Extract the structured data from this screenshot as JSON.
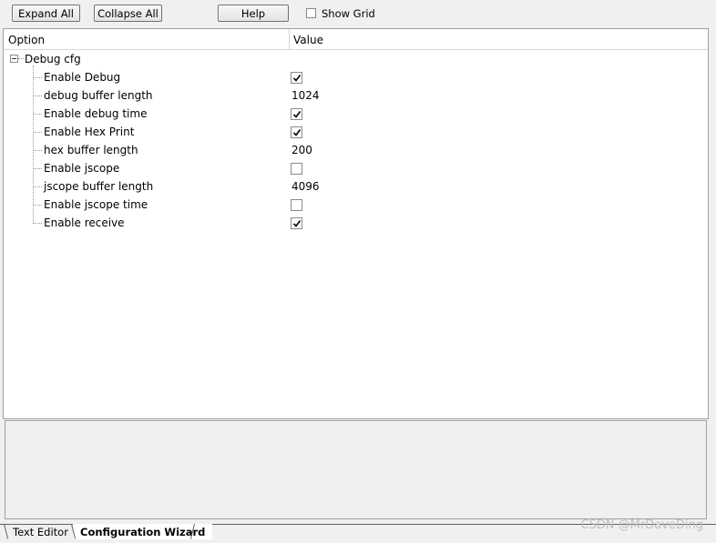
{
  "toolbar": {
    "expand_all": "Expand All",
    "collapse_all": "Collapse All",
    "help": "Help",
    "show_grid": "Show Grid",
    "show_grid_checked": false
  },
  "grid": {
    "columns": [
      "Option",
      "Value"
    ],
    "group": "Debug cfg",
    "group_expanded": true,
    "rows": [
      {
        "label": "Enable Debug",
        "type": "checkbox",
        "checked": true
      },
      {
        "label": "debug buffer length",
        "type": "number",
        "value": "1024"
      },
      {
        "label": "Enable debug time",
        "type": "checkbox",
        "checked": true
      },
      {
        "label": "Enable Hex Print",
        "type": "checkbox",
        "checked": true
      },
      {
        "label": "hex buffer length",
        "type": "number",
        "value": "200"
      },
      {
        "label": "Enable jscope",
        "type": "checkbox",
        "checked": false
      },
      {
        "label": "jscope buffer length",
        "type": "number",
        "value": "4096"
      },
      {
        "label": "Enable jscope time",
        "type": "checkbox",
        "checked": false
      },
      {
        "label": "Enable receive",
        "type": "checkbox",
        "checked": true
      }
    ]
  },
  "tabs": [
    {
      "label": "Text Editor",
      "active": false
    },
    {
      "label": "Configuration Wizard",
      "active": true
    }
  ],
  "watermark": "CSDN @MrDaveDing",
  "colors": {
    "background": "#f0f0f0",
    "grid_background": "#ffffff",
    "border": "#a0a0a0"
  }
}
